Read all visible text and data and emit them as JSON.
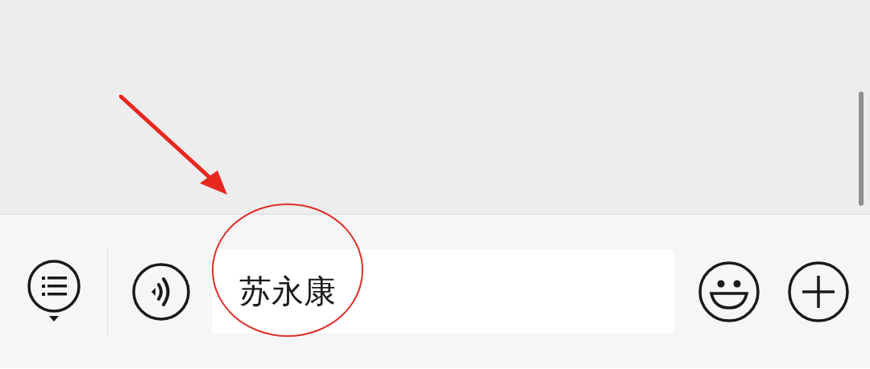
{
  "input_bar": {
    "message_input": {
      "value": "苏永康"
    }
  }
}
